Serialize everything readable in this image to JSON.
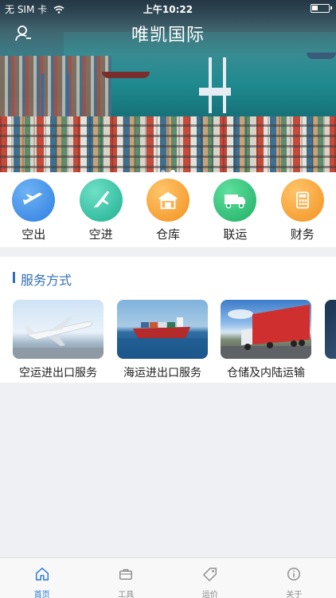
{
  "status_bar": {
    "carrier": "无 SIM 卡",
    "time": "上午10:22",
    "icons": [
      "wifi-icon",
      "battery-icon"
    ]
  },
  "header": {
    "title": "唯凯国际",
    "user_icon": "user-icon"
  },
  "banner": {
    "slides_count": 2,
    "active_index": 1
  },
  "categories": [
    {
      "label": "空出",
      "icon": "airplane-depart-icon",
      "color": "#3f8fe6"
    },
    {
      "label": "空进",
      "icon": "airplane-arrive-icon",
      "color": "#2ec2a6"
    },
    {
      "label": "仓库",
      "icon": "warehouse-icon",
      "color": "#f6a23a"
    },
    {
      "label": "联运",
      "icon": "truck-icon",
      "color": "#2cc07a"
    },
    {
      "label": "财务",
      "icon": "calculator-icon",
      "color": "#f6a23a"
    }
  ],
  "services": {
    "title": "服务方式",
    "items": [
      {
        "caption": "空运进出口服务",
        "image": "airplane-photo"
      },
      {
        "caption": "海运进出口服务",
        "image": "cargo-ship-photo"
      },
      {
        "caption": "仓储及内陆运输",
        "image": "truck-photo"
      }
    ]
  },
  "tabbar": {
    "active": 0,
    "tabs": [
      {
        "label": "首页",
        "icon": "home-icon"
      },
      {
        "label": "工具",
        "icon": "toolbox-icon"
      },
      {
        "label": "运价",
        "icon": "price-tag-icon"
      },
      {
        "label": "关于",
        "icon": "info-icon"
      }
    ]
  },
  "colors": {
    "accent": "#2a7ad6",
    "section_title": "#2f6fb6"
  }
}
